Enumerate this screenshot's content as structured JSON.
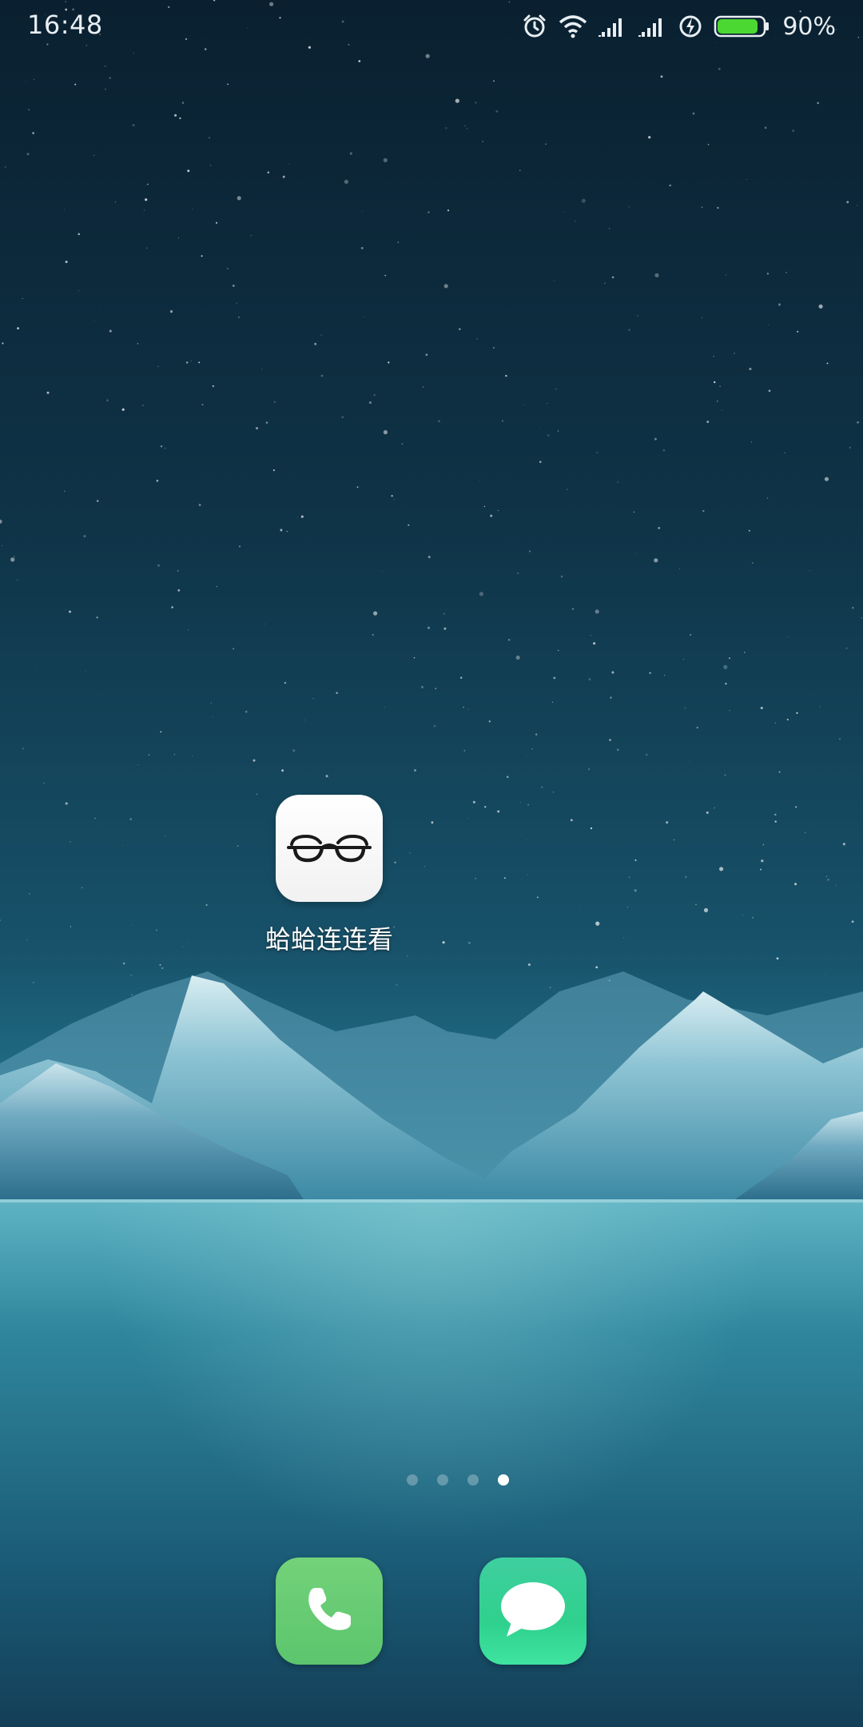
{
  "status_bar": {
    "time": "16:48",
    "battery_percent": "90%",
    "battery_level": 0.9,
    "icons": [
      "alarm-icon",
      "wifi-icon",
      "signal-icon",
      "signal-icon",
      "charging-icon",
      "battery-icon"
    ]
  },
  "home": {
    "apps": [
      {
        "label": "蛤蛤连连看",
        "icon": "glasses-icon"
      }
    ]
  },
  "page_indicator": {
    "count": 4,
    "active_index": 3
  },
  "dock": {
    "items": [
      {
        "icon": "phone-icon",
        "color": "#62c96f"
      },
      {
        "icon": "message-icon",
        "color": "#35d395"
      }
    ]
  }
}
